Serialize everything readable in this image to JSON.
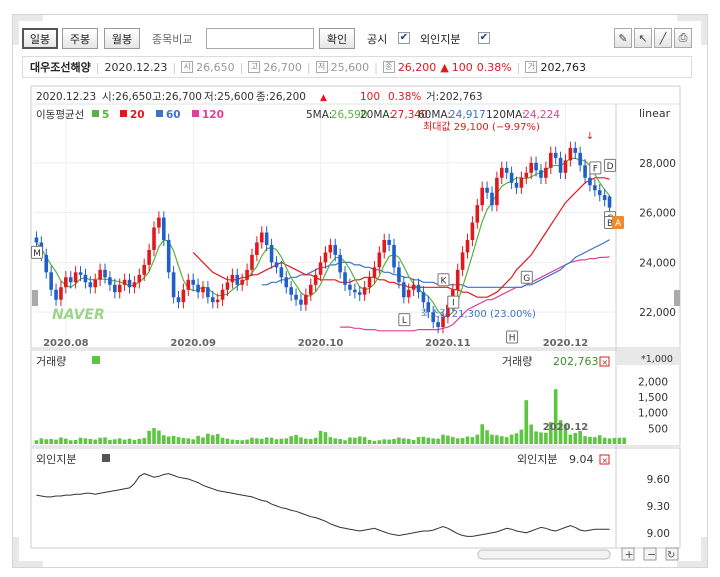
{
  "toolbar": {
    "period_tabs": [
      "일봉",
      "주봉",
      "월봉"
    ],
    "compare_label": "종목비교",
    "compare_placeholder": "",
    "confirm_label": "확인",
    "disclosure_label": "공시",
    "disclosure_checked": "✔",
    "foreign_label": "외인지분",
    "foreign_checked": "✔"
  },
  "info_bar": {
    "name": "대우조선해양",
    "date": "2020.12.23",
    "open_icon": "시",
    "open": "26,650",
    "high_icon": "고",
    "high": "26,700",
    "low_icon": "저",
    "low": "25,600",
    "close_icon": "종",
    "close": "26,200",
    "change_arrow": "▲",
    "change": "100",
    "change_pct": "0.38%",
    "volume_icon": "거",
    "volume": "202,763"
  },
  "price_panel": {
    "ohlc_line": {
      "date": "2020.12.23",
      "open": "시:26,650",
      "high": "고:26,700",
      "low": "저:25,600",
      "close": "종:26,200",
      "arrow": "▲",
      "change": "100",
      "pct": "0.38%",
      "vol": "거:202,763"
    },
    "scale_label": "linear",
    "ma_legend": {
      "title": "이동평균선",
      "items": [
        {
          "label": "5",
          "color": "#57b33e"
        },
        {
          "label": "20",
          "color": "#e0191d"
        },
        {
          "label": "60",
          "color": "#3b73c9"
        },
        {
          "label": "120",
          "color": "#e0409a"
        }
      ]
    },
    "ma_values": [
      {
        "label": "5MA:",
        "value": "26,590",
        "color": "#57b33e"
      },
      {
        "label": "20MA:",
        "value": "27,340",
        "color": "#e0191d"
      },
      {
        "label": "60MA:",
        "value": "24,917",
        "color": "#3b73c9"
      },
      {
        "label": "120MA:",
        "value": "24,224",
        "color": "#e0409a"
      }
    ],
    "max_annotation": "최대값 29,100 (−9.97%)",
    "min_annotation": "최소값 21,300 (23.00%)",
    "watermark": "NAVER",
    "y_ticks": [
      "28,000",
      "26,000",
      "24,000",
      "22,000"
    ],
    "x_ticks": [
      "2020.08",
      "2020.09",
      "2020.10",
      "2020.11",
      "2020.12"
    ],
    "event_markers": [
      "M",
      "L",
      "K",
      "I",
      "H",
      "G",
      "F",
      "D",
      "C",
      "B",
      "A"
    ]
  },
  "volume_panel": {
    "title": "거래량",
    "value_label": "거래량",
    "value": "202,763",
    "unit_label": "*1,000",
    "y_ticks": [
      "2,000",
      "1,500",
      "1,000",
      "500"
    ],
    "x_tick": "2020.12"
  },
  "foreign_panel": {
    "title": "외인지분",
    "value_label": "외인지분",
    "value": "9.04",
    "y_ticks": [
      "9.60",
      "9.30",
      "9.00"
    ]
  },
  "colors": {
    "up": "#e0191d",
    "down": "#1f5fc7",
    "ma5": "#57b33e",
    "ma20": "#e0191d",
    "ma60": "#3b73c9",
    "ma120": "#e0409a",
    "volume_bar": "#5cc641"
  },
  "chart_data": {
    "type": "candlestick",
    "price_range": [
      20800,
      29400
    ],
    "x_labels": [
      "2020.08",
      "2020.09",
      "2020.10",
      "2020.11",
      "2020.12"
    ],
    "last_candle": {
      "date": "2020.12.23",
      "open": 26650,
      "high": 26700,
      "low": 25600,
      "close": 26200
    },
    "ma_last": {
      "ma5": 26590,
      "ma20": 27340,
      "ma60": 24917,
      "ma120": 24224
    },
    "max": {
      "value": 29100,
      "pct": -9.97
    },
    "min": {
      "value": 21300,
      "pct": 23.0
    },
    "closes": [
      24800,
      24300,
      23600,
      22900,
      22500,
      23000,
      23400,
      23200,
      23600,
      23500,
      23200,
      23000,
      23300,
      23700,
      23400,
      23100,
      22800,
      23100,
      23300,
      23000,
      23200,
      23500,
      23900,
      24500,
      25400,
      25800,
      24900,
      23600,
      22600,
      22400,
      22900,
      23300,
      23100,
      22800,
      23000,
      22600,
      22400,
      22500,
      22900,
      23200,
      23500,
      23100,
      23300,
      23700,
      24300,
      24800,
      25200,
      24700,
      24000,
      23800,
      23400,
      23000,
      22700,
      22500,
      22300,
      22700,
      23100,
      23500,
      24000,
      24400,
      24700,
      24300,
      23600,
      23100,
      22900,
      22800,
      22700,
      23000,
      23400,
      23800,
      24400,
      24900,
      24700,
      23800,
      23200,
      22600,
      22900,
      23100,
      22800,
      22400,
      22000,
      21600,
      21400,
      21800,
      22300,
      22900,
      23700,
      24400,
      24900,
      25600,
      26300,
      27000,
      26800,
      26300,
      27400,
      27800,
      27600,
      27200,
      27000,
      27400,
      27600,
      28000,
      27700,
      27400,
      27800,
      28400,
      28200,
      27600,
      28100,
      28600,
      28400,
      27900,
      27400,
      27100,
      26900,
      26700,
      26500,
      26200
    ],
    "ma20": [
      24400,
      24200,
      24000,
      23800,
      23600,
      23500,
      23400,
      23300,
      23300,
      23300,
      23400,
      23400,
      23500,
      23500,
      23600,
      23700,
      23800,
      23900,
      24000,
      23900,
      23800,
      23700,
      23600,
      23500,
      23500,
      23400,
      23300,
      23300,
      23300,
      23300,
      23200,
      23200,
      23200,
      23300,
      23300,
      23400,
      23400,
      23400,
      23300,
      23300,
      23200,
      23200,
      23100,
      23100,
      23000,
      23000,
      23000,
      23000,
      23000,
      23000,
      23000,
      23000,
      23000,
      22900,
      22900,
      22800,
      22800,
      22700,
      22600,
      22600,
      22600,
      22700,
      22800,
      23000,
      23200,
      23400,
      23700,
      23900,
      24100,
      24300,
      24600,
      24900,
      25200,
      25500,
      25800,
      26100,
      26400,
      26600,
      26800,
      27000,
      27200,
      27300,
      27400,
      27400,
      27400,
      27340
    ],
    "ma60": [
      23100,
      23100,
      23200,
      23200,
      23300,
      23300,
      23400,
      23400,
      23500,
      23500,
      23600,
      23700,
      23800,
      23800,
      23900,
      23900,
      24000,
      24000,
      24000,
      23900,
      23900,
      23800,
      23800,
      23700,
      23700,
      23600,
      23600,
      23500,
      23500,
      23400,
      23400,
      23300,
      23300,
      23200,
      23200,
      23200,
      23100,
      23100,
      23100,
      23100,
      23100,
      23100,
      23000,
      23000,
      23000,
      23000,
      23000,
      23000,
      23000,
      23000,
      23000,
      23000,
      23000,
      23000,
      23100,
      23100,
      23200,
      23300,
      23400,
      23500,
      23600,
      23700,
      23900,
      24000,
      24200,
      24300,
      24400,
      24500,
      24600,
      24700,
      24800,
      24917
    ],
    "ma120": [
      21400,
      21400,
      21400,
      21350,
      21350,
      21300,
      21300,
      21300,
      21250,
      21250,
      21250,
      21250,
      21250,
      21250,
      21250,
      21250,
      21300,
      21300,
      21300,
      21300,
      21300,
      21350,
      21400,
      21500,
      21700,
      21900,
      22100,
      22200,
      22300,
      22400,
      22500,
      22500,
      22600,
      22700,
      22800,
      22900,
      23000,
      23000,
      23100,
      23200,
      23300,
      23400,
      23500,
      23600,
      23700,
      23800,
      23900,
      24000,
      24050,
      24100,
      24100,
      24150,
      24150,
      24200,
      24200,
      24224
    ],
    "volume": [
      120,
      180,
      150,
      160,
      140,
      210,
      170,
      120,
      130,
      200,
      180,
      160,
      140,
      200,
      210,
      130,
      150,
      180,
      140,
      170,
      130,
      160,
      190,
      420,
      510,
      430,
      280,
      240,
      260,
      220,
      190,
      180,
      150,
      260,
      210,
      330,
      280,
      320,
      200,
      170,
      140,
      130,
      120,
      140,
      200,
      180,
      160,
      210,
      200,
      150,
      170,
      180,
      250,
      290,
      210,
      170,
      160,
      200,
      420,
      380,
      220,
      180,
      160,
      120,
      210,
      200,
      240,
      220,
      130,
      100,
      120,
      150,
      140,
      160,
      210,
      180,
      160,
      130,
      220,
      230,
      200,
      180,
      170,
      300,
      270,
      220,
      180,
      190,
      240,
      220,
      300,
      630,
      440,
      300,
      280,
      250,
      220,
      300,
      340,
      460,
      1400,
      620,
      400,
      370,
      360,
      700,
      1750,
      760,
      620,
      300,
      350,
      420,
      250,
      230,
      220,
      280,
      200,
      180,
      190,
      200,
      203
    ],
    "foreign": [
      9.42,
      9.41,
      9.4,
      9.4,
      9.41,
      9.41,
      9.42,
      9.42,
      9.43,
      9.43,
      9.44,
      9.44,
      9.43,
      9.44,
      9.45,
      9.46,
      9.47,
      9.48,
      9.49,
      9.5,
      9.55,
      9.63,
      9.66,
      9.64,
      9.62,
      9.63,
      9.65,
      9.66,
      9.64,
      9.62,
      9.61,
      9.6,
      9.58,
      9.56,
      9.53,
      9.51,
      9.49,
      9.47,
      9.46,
      9.45,
      9.44,
      9.43,
      9.42,
      9.41,
      9.4,
      9.38,
      9.36,
      9.35,
      9.32,
      9.3,
      9.28,
      9.27,
      9.25,
      9.24,
      9.22,
      9.2,
      9.18,
      9.17,
      9.15,
      9.13,
      9.1,
      9.08,
      9.06,
      9.05,
      9.04,
      9.03,
      9.02,
      9.03,
      9.04,
      9.05,
      9.03,
      9.01,
      8.99,
      8.98,
      8.97,
      8.98,
      8.99,
      9.0,
      9.01,
      9.02,
      9.02,
      9.03,
      9.05,
      9.07,
      9.05,
      9.02,
      8.99,
      8.97,
      8.96,
      8.96,
      8.97,
      8.98,
      8.99,
      9.0,
      9.01,
      9.03,
      9.05,
      9.04,
      9.02,
      9.01,
      9.0,
      9.02,
      9.04,
      9.06,
      9.05,
      9.03,
      9.02,
      9.04,
      9.06,
      9.08,
      9.06,
      9.03,
      9.02,
      9.03,
      9.04,
      9.04,
      9.04,
      9.04
    ]
  }
}
